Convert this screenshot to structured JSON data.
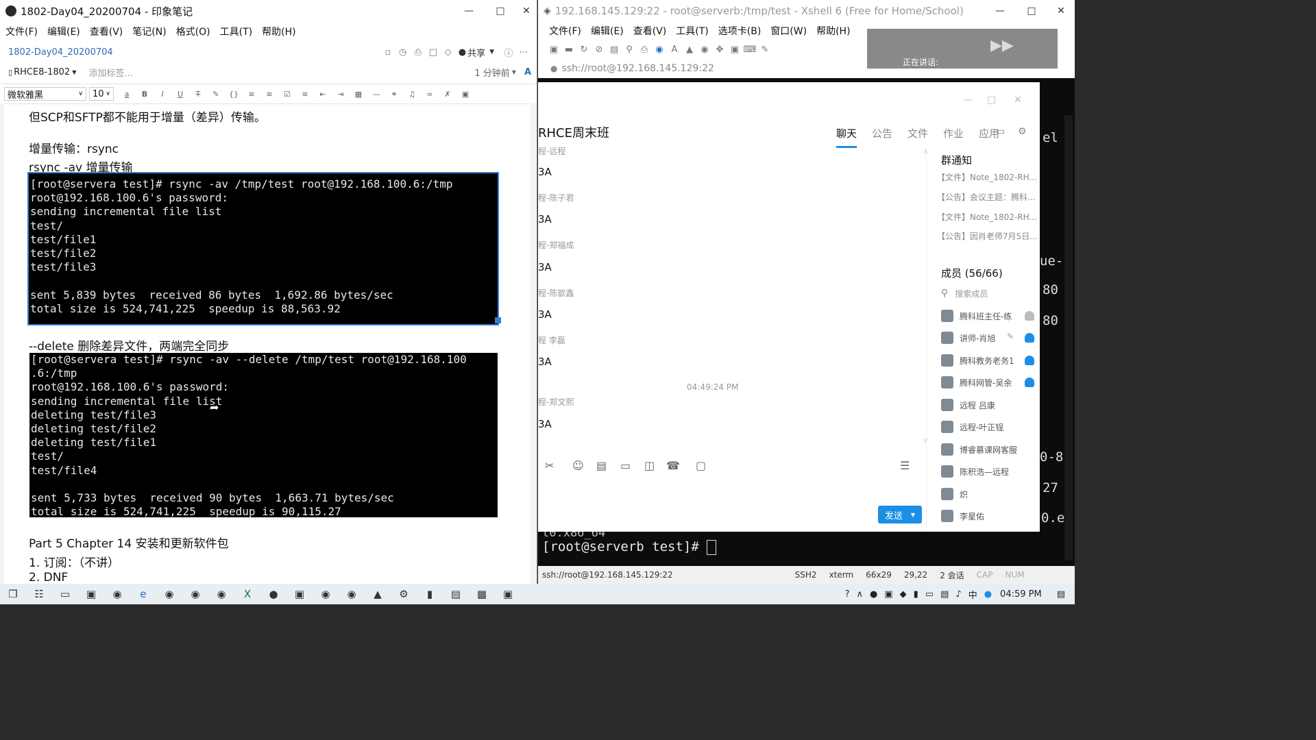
{
  "evernote": {
    "window_title": "1802-Day04_20200704 - 印象笔记",
    "menu": [
      "文件(F)",
      "编辑(E)",
      "查看(V)",
      "笔记(N)",
      "格式(O)",
      "工具(T)",
      "帮助(H)"
    ],
    "note_title": "1802-Day04_20200704",
    "share_label": "共享",
    "notebook": "RHCE8-1802",
    "add_tag_placeholder": "添加标签...",
    "modified": "1 分钟前",
    "font_family": "微软雅黑",
    "font_size": "10",
    "lines": {
      "l1": "但SCP和SFTP都不能用于增量（差异）传输。",
      "l2": "增量传输：rsync",
      "l3": "rsync -av  增量传输",
      "l4": "--delete 删除差异文件，两端完全同步",
      "l5": "Part 5 Chapter 14 安装和更新软件包",
      "l6": "1. 订阅：（不讲）",
      "l7": "2. DNF"
    },
    "term1": [
      "[root@servera test]# rsync -av /tmp/test root@192.168.100.6:/tmp",
      "root@192.168.100.6's password:",
      "sending incremental file list",
      "test/",
      "test/file1",
      "test/file2",
      "test/file3",
      "",
      "sent 5,839 bytes  received 86 bytes  1,692.86 bytes/sec",
      "total size is 524,741,225  speedup is 88,563.92"
    ],
    "term2": [
      "[root@servera test]# rsync -av --delete /tmp/test root@192.168.100",
      ".6:/tmp",
      "root@192.168.100.6's password:",
      "sending incremental file list",
      "deleting test/file3",
      "deleting test/file2",
      "deleting test/file1",
      "test/",
      "test/file4",
      "",
      "sent 5,733 bytes  received 90 bytes  1,663.71 bytes/sec",
      "total size is 524,741,225  speedup is 90,115.27"
    ]
  },
  "xshell": {
    "window_title": "192.168.145.129:22 - root@serverb:/tmp/test - Xshell 6 (Free for Home/School)",
    "menu": [
      "文件(F)",
      "编辑(E)",
      "查看(V)",
      "工具(T)",
      "选项卡(B)",
      "窗口(W)",
      "帮助(H)"
    ],
    "address": "ssh://root@192.168.145.129:22",
    "overlay_text": "正在讲话:",
    "prompt": "[root@serverb test]# ",
    "arch_fragment": "t0.x86_64",
    "right_fragments": [
      "el",
      "ue-",
      "80",
      "80",
      "0-8",
      "27",
      "0.e"
    ],
    "status": {
      "address": "ssh://root@192.168.145.129:22",
      "protocol": "SSH2",
      "term": "xterm",
      "size": "66x29",
      "cursor": "29,22",
      "sessions": "2 会话",
      "caps": "CAP",
      "num": "NUM"
    }
  },
  "qq": {
    "group_name": "RHCE周末班",
    "tabs": [
      "聊天",
      "公告",
      "文件",
      "作业",
      "应用"
    ],
    "chat": [
      {
        "name": "程-远程",
        "msg": "3A"
      },
      {
        "name": "程-陈子君",
        "msg": "3A"
      },
      {
        "name": "程-郑福成",
        "msg": "3A"
      },
      {
        "name": "程-陈歆鑫",
        "msg": "3A"
      },
      {
        "name": "程 李磊",
        "msg": "3A"
      },
      {
        "name": "程-郑文熙",
        "msg": "3A"
      }
    ],
    "time": "04:49:24 PM",
    "notice_title": "群通知",
    "notices": [
      "【文件】Note_1802-RH...",
      "【公告】会议主题：腾科...",
      "【文件】Note_1802-RH...",
      "【公告】因肖老师7月5日..."
    ],
    "members_title": "成员 (56/66)",
    "search_members": "搜索成员",
    "members": [
      "腾科班主任-练",
      "讲师-肖旭",
      "腾科教务老务1",
      "腾科网管-吴余",
      "远程 吕康",
      "远程-叶正锃",
      "博睿慕课网客服",
      "陈积浩—远程",
      "炽",
      "李星佑"
    ],
    "send_label": "发送"
  },
  "taskbar": {
    "clock": "04:59 PM"
  }
}
